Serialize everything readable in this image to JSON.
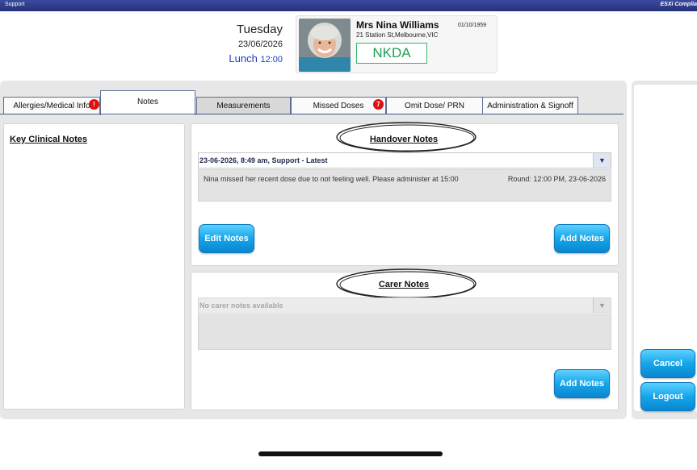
{
  "titlebar": {
    "left": "Support",
    "right": "ESXi Complia"
  },
  "header": {
    "day": "Tuesday",
    "date": "23/06/2026",
    "meal": "Lunch",
    "meal_time": "12:00"
  },
  "patient": {
    "name": "Mrs Nina Williams",
    "dob": "01/10/1959",
    "address": "21 Station St,Melbourne,VIC",
    "allergy_status": "NKDA"
  },
  "tabs": [
    {
      "label": "Allergies/Medical Info",
      "badge": "!"
    },
    {
      "label": "Notes"
    },
    {
      "label": "Measurements"
    },
    {
      "label": "Missed Doses",
      "badge": "7"
    },
    {
      "label": "Omit Dose/ PRN"
    },
    {
      "label": "Administration & Signoff"
    }
  ],
  "key_clinical": {
    "title": "Key Clinical Notes"
  },
  "handover": {
    "title": "Handover Notes",
    "selected": "23-06-2026, 8:49 am, Support - Latest",
    "note_text": "Nina missed her recent dose due to not feeling well. Please administer at 15:00",
    "note_round": "Round: 12:00 PM, 23-06-2026",
    "edit_label": "Edit Notes",
    "add_label": "Add Notes"
  },
  "carer": {
    "title": "Carer Notes",
    "placeholder": "No carer notes available",
    "add_label": "Add Notes"
  },
  "actions": {
    "cancel": "Cancel",
    "logout": "Logout"
  },
  "icons": {
    "dropdown": "chevron-down-icon"
  },
  "colors": {
    "accent": "#14a6ea",
    "badge": "#e01010",
    "nkda": "#1f9e56",
    "meal": "#1a3cc7"
  }
}
